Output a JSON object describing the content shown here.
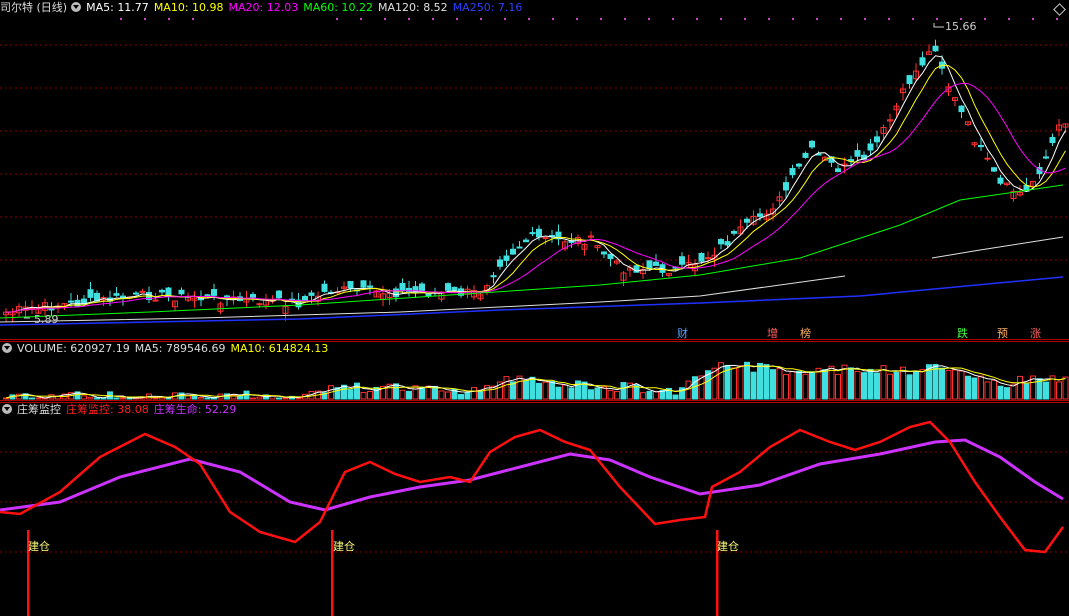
{
  "main": {
    "title": "司尔特 (日线)",
    "ma": [
      {
        "label": "MA5: ",
        "value": "11.77",
        "color": "#ffffff"
      },
      {
        "label": "MA10: ",
        "value": "10.98",
        "color": "#ffff00"
      },
      {
        "label": "MA20: ",
        "value": "12.03",
        "color": "#ff00ff"
      },
      {
        "label": "MA60: ",
        "value": "10.22",
        "color": "#00ff00"
      },
      {
        "label": "MA120: ",
        "value": "8.52",
        "color": "#e0e0e0"
      },
      {
        "label": "MA250: ",
        "value": "7.16",
        "color": "#2030ff"
      }
    ],
    "high_label": "15.66",
    "low_label": "5.89",
    "events": [
      {
        "text": "财",
        "color": "#5aa0ff"
      },
      {
        "text": "增",
        "color": "#ff6060"
      },
      {
        "text": "榜",
        "color": "#ffb060"
      },
      {
        "text": "跌",
        "color": "#40ff40"
      },
      {
        "text": "预",
        "color": "#ffb060"
      },
      {
        "text": "涨",
        "color": "#ff6060"
      }
    ]
  },
  "volume": {
    "label": "VOLUME: ",
    "value": "620927.19",
    "ma5_label": "MA5: ",
    "ma5_value": "789546.69",
    "ma10_label": "MA10: ",
    "ma10_value": "614824.13"
  },
  "indicator": {
    "name": "庄筹监控",
    "line1_label": "庄筹监控: ",
    "line1_value": "38.08",
    "line2_label": "庄筹生命: ",
    "line2_value": "52.29",
    "signal_text": "建仓",
    "signals": [
      "建仓",
      "建仓",
      "建仓"
    ]
  },
  "colors": {
    "up": "#ff3030",
    "down": "#40e0e0",
    "grid": "#8b0000",
    "frame": "#b00000"
  }
}
